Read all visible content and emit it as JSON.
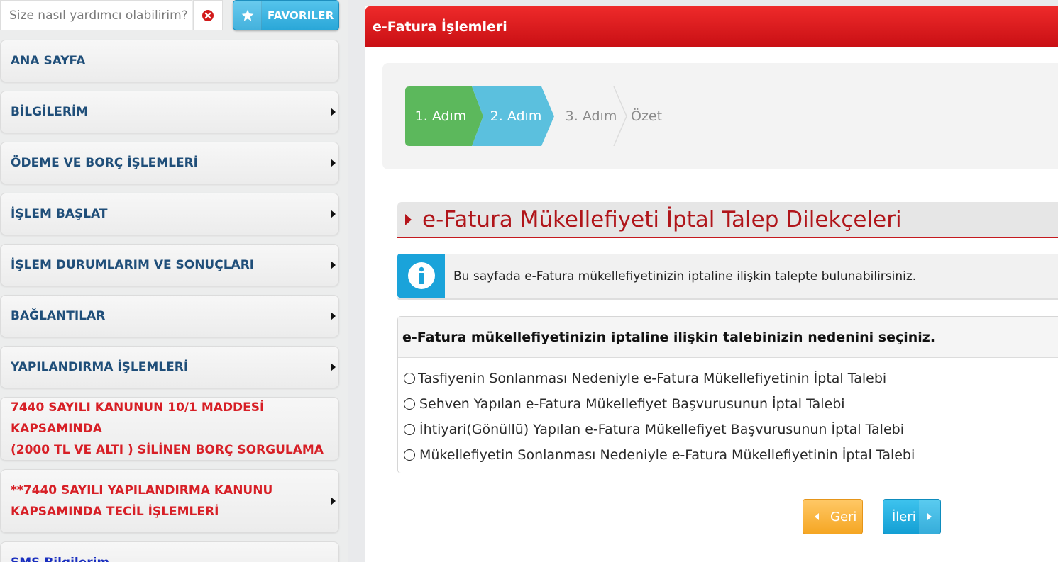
{
  "search": {
    "placeholder": "Size nasıl yardımcı olabilirim?",
    "favorites_label": "FAVORILER"
  },
  "sidebar": {
    "items": [
      {
        "label": "ANA SAYFA",
        "has_arrow": false
      },
      {
        "label": "BİLGİLERİM",
        "has_arrow": true
      },
      {
        "label": "ÖDEME VE BORÇ İŞLEMLERİ",
        "has_arrow": true
      },
      {
        "label": "İŞLEM BAŞLAT",
        "has_arrow": true
      },
      {
        "label": "İŞLEM DURUMLARIM VE SONUÇLARI",
        "has_arrow": true
      },
      {
        "label": "BAĞLANTILAR",
        "has_arrow": true
      },
      {
        "label": "YAPILANDIRMA İŞLEMLERİ",
        "has_arrow": true
      },
      {
        "label": "7440 SAYILI KANUNUN 10/1 MADDESİ KAPSAMINDA (2000 TL VE ALTI ) SİLİNEN BORÇ SORGULAMA",
        "line1": "7440 SAYILI KANUNUN 10/1 MADDESİ KAPSAMINDA",
        "line2": "(2000 TL VE ALTI ) SİLİNEN BORÇ SORGULAMA",
        "has_arrow": false
      },
      {
        "label": "**7440 SAYILI YAPILANDIRMA KANUNU KAPSAMINDA TECİL İŞLEMLERİ",
        "line1": "**7440 SAYILI YAPILANDIRMA KANUNU",
        "line2": "KAPSAMINDA TECİL İŞLEMLERİ",
        "has_arrow": true
      },
      {
        "label": "SMS Bilgilerim",
        "has_arrow": false
      }
    ]
  },
  "main": {
    "header_title": "e-Fatura İşlemleri",
    "steps": [
      {
        "label": "1. Adım",
        "state": "completed"
      },
      {
        "label": "2. Adım",
        "state": "active"
      },
      {
        "label": "3. Adım",
        "state": "pending"
      },
      {
        "label": "Özet",
        "state": "pending"
      }
    ],
    "section_title": "e-Fatura Mükellefiyeti İptal Talep Dilekçeleri",
    "info_text": "Bu sayfada e-Fatura mükellefiyetinizin iptaline ilişkin talepte bulunabilirsiniz.",
    "reason_question": "e-Fatura mükellefiyetinizin iptaline ilişkin talebinizin nedenini seçiniz.",
    "options": [
      "Tasfiyenin Sonlanması Nedeniyle e-Fatura Mükellefiyetinin İptal Talebi",
      "Sehven Yapılan e-Fatura Mükellefiyet Başvurusunun İptal Talebi",
      "İhtiyari(Gönüllü) Yapılan e-Fatura Mükellefiyet Başvurusunun İptal Talebi",
      "Mükellefiyetin Sonlanması Nedeniyle e-Fatura Mükellefiyetinin İptal Talebi"
    ],
    "back_label": "Geri",
    "next_label": "İleri"
  },
  "colors": {
    "header_red": "#d81b20",
    "step_completed": "#5cb85c",
    "step_active": "#5bc0de",
    "fav_blue": "#2aa7d8",
    "back_orange": "#f5a623",
    "next_blue": "#139fd4",
    "menu_text": "#1f4e79",
    "menu_red_text": "#d71f26"
  },
  "icons": {
    "clear": "close-circle-icon",
    "favorites": "star-icon",
    "info": "info-icon",
    "menu_arrow": "caret-right-icon",
    "back": "chevron-left-icon",
    "next": "chevron-right-icon"
  }
}
